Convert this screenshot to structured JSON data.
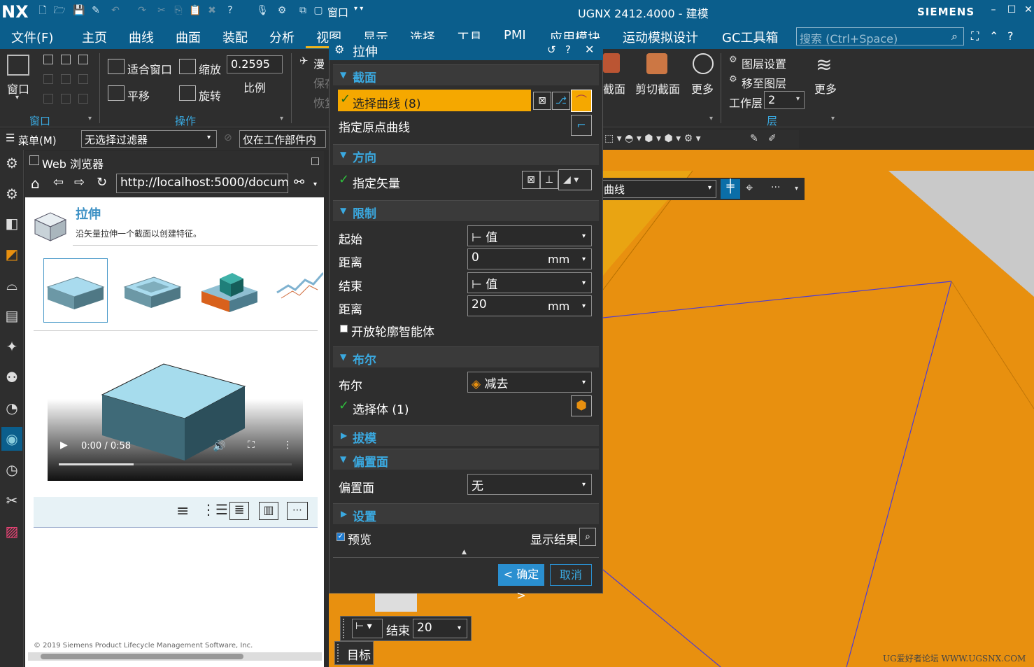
{
  "titlebar": {
    "logo": "NX",
    "window_menu": "窗口",
    "title": "UGNX 2412.4000 - 建模",
    "brand": "SIEMENS"
  },
  "menu": {
    "tabs": [
      "文件(F)",
      "主页",
      "曲线",
      "曲面",
      "装配",
      "分析",
      "视图",
      "显示",
      "选择",
      "工具",
      "PMI",
      "应用模块",
      "运动模拟设计",
      "GC工具箱"
    ],
    "active": "视图",
    "search_placeholder": "搜索 (Ctrl+Space)"
  },
  "ribbon": {
    "window_label": "窗口",
    "fit_window": "适合窗口",
    "zoom": "缩放",
    "scale_value": "0.2595",
    "pan": "平移",
    "rotate": "旋转",
    "scale_label": "比例",
    "group_window": "窗口",
    "group_operation": "操作",
    "roam": "漫",
    "save": "保存",
    "restore": "恢复",
    "section": "截面",
    "clip_section": "剪切截面",
    "more1": "更多",
    "layer_settings": "图层设置",
    "move_to_layer": "移至图层",
    "work_layer_label": "工作层",
    "work_layer_value": "2",
    "more2": "更多",
    "group_layer": "层"
  },
  "filterbar": {
    "menu": "菜单(M)",
    "filter": "无选择过滤器",
    "scope": "仅在工作部件内",
    "curve_rule": "曲线"
  },
  "browser": {
    "title": "Web 浏览器",
    "url": "http://localhost:5000/document",
    "heading": "拉伸",
    "desc": "沿矢量拉伸一个截面以创建特征。",
    "video_time": "0:00 / 0:58",
    "video_progress": 0.32,
    "copyright": "© 2019 Siemens Product Lifecycle Management Software, Inc."
  },
  "dialog": {
    "title": "拉伸",
    "sec_section": "截面",
    "select_curve": "选择曲线 (8)",
    "specify_origin_curve": "指定原点曲线",
    "sec_direction": "方向",
    "specify_vector": "指定矢量",
    "sec_limits": "限制",
    "start_label": "起始",
    "start_value": "值",
    "dist1_label": "距离",
    "dist1_value": "0",
    "unit": "mm",
    "end_label": "结束",
    "end_value": "值",
    "dist2_label": "距离",
    "dist2_value": "20",
    "open_profile": "开放轮廓智能体",
    "sec_bool": "布尔",
    "bool_label": "布尔",
    "bool_value": "减去",
    "select_body": "选择体 (1)",
    "sec_draft": "拔模",
    "sec_offset": "偏置面",
    "offset_label": "偏置面",
    "offset_value": "无",
    "sec_settings": "设置",
    "preview": "预览",
    "show_result": "显示结果",
    "ok": "确定",
    "cancel": "取消"
  },
  "handle": {
    "end_label": "结束",
    "end_value": "20",
    "target": "目标"
  },
  "watermark": "UG爱好者论坛 WWW.UGSNX.COM",
  "colors": {
    "title_blue": "#0b5e8c",
    "accent_orange": "#f5a800",
    "panel_dark": "#2e2e2e",
    "model_orange": "#e8900f"
  }
}
